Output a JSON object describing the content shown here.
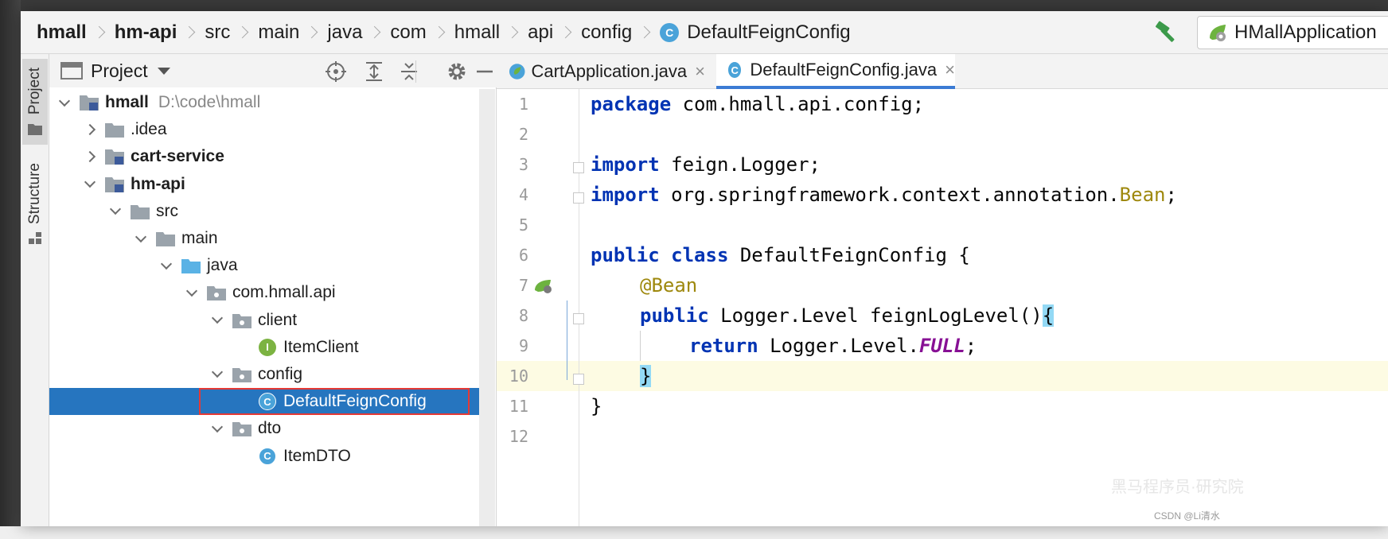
{
  "breadcrumb": {
    "items": [
      "hmall",
      "hm-api",
      "src",
      "main",
      "java",
      "com",
      "hmall",
      "api",
      "config"
    ],
    "class_name": "DefaultFeignConfig",
    "class_badge": "C"
  },
  "toolbar": {
    "build_icon": "hammer-icon",
    "run_config": "HMallApplication"
  },
  "tool_strip": {
    "project_label": "Project",
    "structure_label": "Structure"
  },
  "project_panel": {
    "title": "Project",
    "icons": [
      "locate-icon",
      "expand-all-icon",
      "collapse-all-icon",
      "gear-icon",
      "minimize-icon"
    ],
    "tree": [
      {
        "label": "hmall",
        "path": "D:\\code\\hmall",
        "bold": true,
        "expanded": true
      },
      {
        "label": ".idea",
        "expanded": false
      },
      {
        "label": "cart-service",
        "bold": true,
        "expanded": false
      },
      {
        "label": "hm-api",
        "bold": true,
        "expanded": true
      },
      {
        "label": "src",
        "expanded": true
      },
      {
        "label": "main",
        "expanded": true
      },
      {
        "label": "java",
        "expanded": true
      },
      {
        "label": "com.hmall.api",
        "expanded": true
      },
      {
        "label": "client",
        "expanded": true
      },
      {
        "label": "ItemClient",
        "badge": "I"
      },
      {
        "label": "config",
        "expanded": true
      },
      {
        "label": "DefaultFeignConfig",
        "badge": "C",
        "selected": true
      },
      {
        "label": "dto",
        "expanded": true
      },
      {
        "label": "ItemDTO",
        "badge": "C"
      }
    ]
  },
  "editor": {
    "tabs": [
      {
        "label": "CartApplication.java",
        "active": false
      },
      {
        "label": "DefaultFeignConfig.java",
        "active": true
      }
    ],
    "close_glyph": "×",
    "line_numbers": [
      "1",
      "2",
      "3",
      "4",
      "5",
      "6",
      "7",
      "8",
      "9",
      "10",
      "11",
      "12"
    ],
    "code": {
      "l1_kw": "package",
      "l1_rest": " com.hmall.api.config;",
      "l3_kw": "import",
      "l3_rest": " feign.Logger;",
      "l4_kw": "import",
      "l4_rest": " org.springframework.context.annotation.",
      "l4_cls": "Bean",
      "l4_end": ";",
      "l6_kw1": "public",
      "l6_kw2": "class",
      "l6_rest": " DefaultFeignConfig {",
      "l7_ann": "@Bean",
      "l8_kw": "public",
      "l8_rest": " Logger.Level feignLogLevel()",
      "l8_brace": "{",
      "l9_kw": "return",
      "l9_rest": " Logger.Level.",
      "l9_fld": "FULL",
      "l9_end": ";",
      "l10_brace": "}",
      "l11": "}"
    }
  },
  "watermark": "CSDN @Li清水",
  "watermark_faint": "黑马程序员·研究院",
  "colors": {
    "keyword": "#0033b3",
    "annotation": "#9e880d",
    "field": "#871094",
    "selection": "#2675bf",
    "class_badge": "#4aa3d9",
    "interface_badge": "#7cb342"
  }
}
